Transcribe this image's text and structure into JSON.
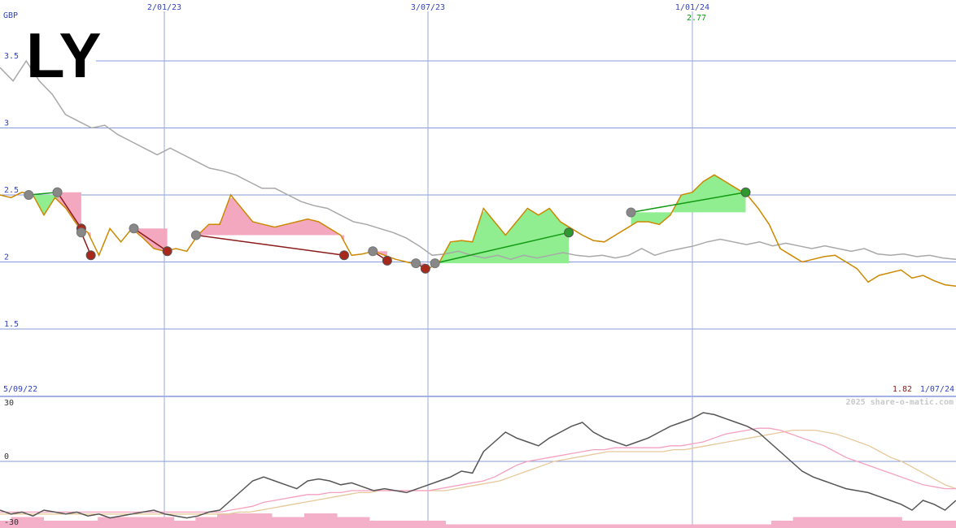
{
  "ticker": "LY",
  "currency": "GBP",
  "watermark": "2025 share-o-matic.com",
  "colors": {
    "price": "#cc8800",
    "ma_long": "#a8a8a8",
    "gain_fill": "#90ee90",
    "loss_fill": "#f4a8c0",
    "gain_line": "#119911",
    "loss_line": "#8b1a1a",
    "grid_h": "#8899dd",
    "grid_v": "#99aadd",
    "axis_text": "#3344bb",
    "osc": "#555555",
    "osc_sig1": "#f4a0c0",
    "osc_sig2": "#e6c89a",
    "vol": "#f4b0c8"
  },
  "chart_data": [
    {
      "type": "line",
      "title": "LY",
      "ylabel": "GBP",
      "ylim": [
        1.5,
        3.7
      ],
      "y_ticks": [
        "3.5",
        "3",
        "2.5",
        "2",
        "1.5"
      ],
      "x_ticks": [
        "2/01/23",
        "3/07/23",
        "1/01/24"
      ],
      "start_label": "5/09/22",
      "end_label": "1/07/24",
      "max_label": "2.77",
      "min_label": "1.82",
      "annotations": {
        "max_value": 2.77,
        "min_value": 1.82
      },
      "series": [
        {
          "values": [
            2.5,
            2.48,
            2.52,
            2.5,
            2.35,
            2.48,
            2.4,
            2.28,
            2.22,
            2.05,
            2.25,
            2.15,
            2.25,
            2.18,
            2.1,
            2.08,
            2.1,
            2.08,
            2.2,
            2.28,
            2.28,
            2.5,
            2.4,
            2.3,
            2.28,
            2.26,
            2.28,
            2.3,
            2.32,
            2.3,
            2.25,
            2.2,
            2.05,
            2.06,
            2.08,
            2.05,
            2.02,
            2.0,
            1.98,
            1.95,
            2.0,
            2.15,
            2.16,
            2.15,
            2.4,
            2.3,
            2.2,
            2.3,
            2.4,
            2.35,
            2.4,
            2.3,
            2.25,
            2.2,
            2.16,
            2.15,
            2.2,
            2.25,
            2.3,
            2.3,
            2.28,
            2.35,
            2.5,
            2.52,
            2.6,
            2.65,
            2.6,
            2.55,
            2.5,
            2.4,
            2.28,
            2.1,
            2.05,
            2.0,
            2.02,
            2.04,
            2.05,
            2.0,
            1.95,
            1.85,
            1.9,
            1.92,
            1.94,
            1.88,
            1.9,
            1.86,
            1.83,
            1.82
          ]
        },
        {
          "values": [
            3.45,
            3.35,
            3.5,
            3.35,
            3.25,
            3.1,
            3.05,
            3.0,
            3.02,
            2.95,
            2.9,
            2.85,
            2.8,
            2.85,
            2.8,
            2.75,
            2.7,
            2.68,
            2.65,
            2.6,
            2.55,
            2.55,
            2.5,
            2.45,
            2.42,
            2.4,
            2.35,
            2.3,
            2.28,
            2.25,
            2.22,
            2.18,
            2.12,
            2.05,
            2.06,
            2.08,
            2.05,
            2.03,
            2.05,
            2.02,
            2.05,
            2.03,
            2.05,
            2.07,
            2.05,
            2.04,
            2.05,
            2.03,
            2.05,
            2.1,
            2.05,
            2.08,
            2.1,
            2.12,
            2.15,
            2.17,
            2.15,
            2.13,
            2.15,
            2.12,
            2.14,
            2.12,
            2.1,
            2.12,
            2.1,
            2.08,
            2.1,
            2.06,
            2.05,
            2.06,
            2.04,
            2.05,
            2.03,
            2.02
          ]
        }
      ],
      "trades": [
        {
          "type": "gain",
          "start_x": 0.03,
          "start_y": 2.5,
          "end_x": 0.06,
          "end_y": 2.52
        },
        {
          "type": "loss",
          "start_x": 0.06,
          "start_y": 2.52,
          "end_x": 0.085,
          "end_y": 2.25
        },
        {
          "type": "loss",
          "start_x": 0.085,
          "start_y": 2.22,
          "end_x": 0.095,
          "end_y": 2.05
        },
        {
          "type": "loss",
          "start_x": 0.14,
          "start_y": 2.25,
          "end_x": 0.175,
          "end_y": 2.08
        },
        {
          "type": "loss",
          "start_x": 0.205,
          "start_y": 2.2,
          "end_x": 0.36,
          "end_y": 2.05
        },
        {
          "type": "loss",
          "start_x": 0.39,
          "start_y": 2.08,
          "end_x": 0.405,
          "end_y": 2.01
        },
        {
          "type": "loss",
          "start_x": 0.435,
          "start_y": 1.99,
          "end_x": 0.445,
          "end_y": 1.95
        },
        {
          "type": "gain",
          "start_x": 0.455,
          "start_y": 1.99,
          "end_x": 0.595,
          "end_y": 2.22
        },
        {
          "type": "gain",
          "start_x": 0.66,
          "start_y": 2.37,
          "end_x": 0.78,
          "end_y": 2.52
        }
      ]
    },
    {
      "type": "line",
      "ylim": [
        -35,
        35
      ],
      "y_ticks": [
        "30",
        "0",
        "-30"
      ],
      "series": [
        {
          "values": [
            -25,
            -27,
            -26,
            -28,
            -25,
            -26,
            -27,
            -26,
            -28,
            -27,
            -29,
            -28,
            -27,
            -26,
            -25,
            -27,
            -28,
            -29,
            -28,
            -26,
            -25,
            -20,
            -15,
            -10,
            -8,
            -10,
            -12,
            -14,
            -10,
            -9,
            -10,
            -12,
            -11,
            -13,
            -15,
            -14,
            -15,
            -16,
            -14,
            -12,
            -10,
            -8,
            -5,
            -6,
            5,
            10,
            15,
            12,
            10,
            8,
            12,
            15,
            18,
            20,
            15,
            12,
            10,
            8,
            10,
            12,
            15,
            18,
            20,
            22,
            25,
            24,
            22,
            20,
            18,
            15,
            10,
            5,
            0,
            -5,
            -8,
            -10,
            -12,
            -14,
            -15,
            -16,
            -18,
            -20,
            -22,
            -25,
            -20,
            -22,
            -25,
            -20
          ]
        },
        {
          "values": [
            -26,
            -26,
            -26,
            -26,
            -26,
            -26,
            -26,
            -26,
            -26,
            -26,
            -26,
            -26,
            -26,
            -26,
            -26,
            -26,
            -26,
            -26,
            -26,
            -26,
            -26,
            -25,
            -24,
            -23,
            -21,
            -20,
            -19,
            -18,
            -17,
            -17,
            -16,
            -16,
            -15,
            -15,
            -15,
            -15,
            -15,
            -15,
            -15,
            -15,
            -14,
            -13,
            -12,
            -11,
            -10,
            -8,
            -5,
            -2,
            0,
            1,
            2,
            3,
            4,
            5,
            6,
            6,
            7,
            7,
            7,
            7,
            7,
            8,
            8,
            9,
            10,
            12,
            14,
            15,
            16,
            17,
            17,
            16,
            14,
            12,
            10,
            8,
            5,
            2,
            0,
            -2,
            -4,
            -6,
            -8,
            -10,
            -12,
            -13,
            -14,
            -14
          ]
        },
        {
          "values": [
            -27,
            -27,
            -27,
            -27,
            -27,
            -27,
            -27,
            -27,
            -27,
            -27,
            -27,
            -27,
            -27,
            -27,
            -27,
            -27,
            -27,
            -27,
            -27,
            -27,
            -27,
            -27,
            -26,
            -26,
            -25,
            -24,
            -23,
            -22,
            -21,
            -20,
            -19,
            -18,
            -17,
            -16,
            -16,
            -15,
            -15,
            -15,
            -15,
            -15,
            -15,
            -15,
            -14,
            -13,
            -12,
            -11,
            -10,
            -8,
            -6,
            -4,
            -2,
            0,
            1,
            2,
            3,
            4,
            5,
            5,
            5,
            5,
            5,
            5,
            6,
            6,
            7,
            8,
            9,
            10,
            11,
            12,
            13,
            14,
            15,
            16,
            16,
            16,
            15,
            14,
            12,
            10,
            8,
            5,
            2,
            0,
            -3,
            -6,
            -9,
            -12,
            -14
          ]
        }
      ],
      "volume": [
        2,
        3,
        3,
        3,
        2,
        2,
        2,
        2,
        2,
        3,
        3,
        3,
        3,
        3,
        3,
        3,
        2,
        2,
        3,
        3,
        4,
        4,
        4,
        4,
        4,
        3,
        3,
        3,
        4,
        4,
        4,
        3,
        3,
        3,
        2,
        2,
        2,
        2,
        2,
        2,
        2,
        1,
        1,
        1,
        1,
        1,
        1,
        1,
        1,
        1,
        1,
        1,
        1,
        1,
        1,
        1,
        1,
        1,
        1,
        1,
        1,
        1,
        1,
        1,
        1,
        1,
        1,
        1,
        1,
        1,
        1,
        2,
        2,
        3,
        3,
        3,
        3,
        3,
        3,
        3,
        3,
        3,
        3,
        2,
        2,
        2,
        2,
        2
      ]
    }
  ]
}
